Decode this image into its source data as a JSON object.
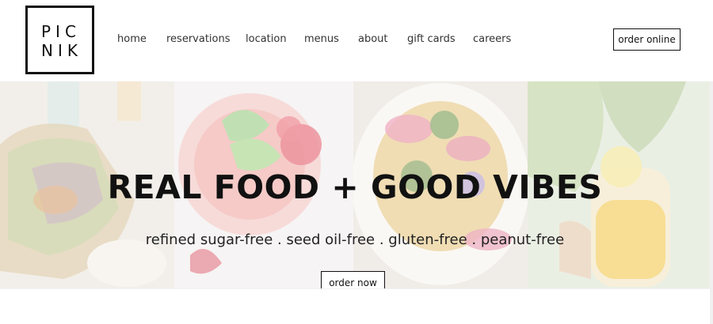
{
  "logo": {
    "line1": "PIC",
    "line2": "NIK"
  },
  "nav": {
    "items": [
      {
        "label": "home"
      },
      {
        "label": "reservations"
      },
      {
        "label": "location"
      },
      {
        "label": "menus"
      },
      {
        "label": "about"
      },
      {
        "label": "gift cards"
      },
      {
        "label": "careers"
      }
    ],
    "order_online": "order online"
  },
  "hero": {
    "headline": "REAL FOOD + GOOD VIBES",
    "subline": "refined sugar-free . seed oil-free . gluten-free . peanut-free",
    "cta": "order now",
    "panels": [
      {
        "subject": "tacos"
      },
      {
        "subject": "smoothie-with-mint-and-strawberry"
      },
      {
        "subject": "salad-bowl"
      },
      {
        "subject": "juice-drink"
      }
    ]
  },
  "colors": {
    "text": "#111111",
    "background": "#ffffff",
    "border": "#111111"
  }
}
